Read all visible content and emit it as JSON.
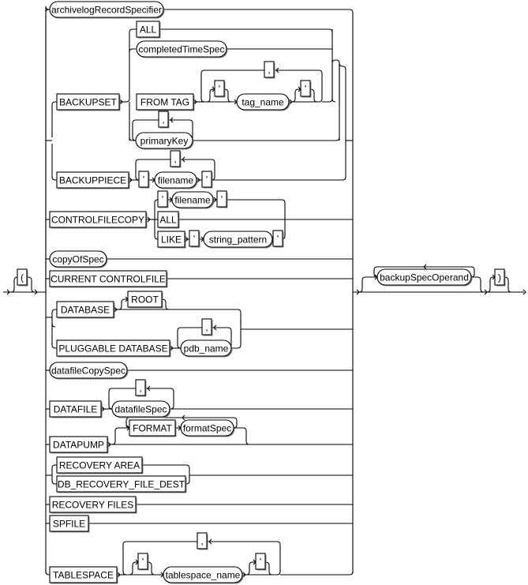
{
  "diagram": {
    "type": "railroad-syntax-diagram",
    "open_paren": "(",
    "close_paren": ")",
    "main_options": [
      {
        "id": "archivelogRecordSpecifier",
        "label": "archivelogRecordSpecifier",
        "kind": "nonterminal"
      },
      {
        "id": "backupset",
        "label": "BACKUPSET",
        "kind": "keyword",
        "sub_options": [
          {
            "label": "ALL",
            "kind": "keyword"
          },
          {
            "label": "completedTimeSpec",
            "kind": "nonterminal"
          },
          {
            "label": "FROM TAG",
            "kind": "keyword",
            "then": [
              {
                "label": "'",
                "kind": "keyword",
                "optional": true
              },
              {
                "label": "tag_name",
                "kind": "nonterminal"
              },
              {
                "label": "'",
                "kind": "keyword",
                "optional": true
              }
            ],
            "repeat_separator": ","
          },
          {
            "label": "primaryKey",
            "kind": "nonterminal",
            "repeat_separator": ","
          }
        ]
      },
      {
        "id": "backuppiece",
        "label": "BACKUPPIECE",
        "kind": "keyword",
        "then": [
          {
            "label": "'",
            "kind": "keyword"
          },
          {
            "label": "filename",
            "kind": "nonterminal"
          },
          {
            "label": "'",
            "kind": "keyword"
          }
        ],
        "repeat_separator": ","
      },
      {
        "id": "controlfilecopy",
        "label": "CONTROLFILECOPY",
        "kind": "keyword",
        "sub_options": [
          {
            "sequence": [
              {
                "label": "'",
                "kind": "keyword"
              },
              {
                "label": "filename",
                "kind": "nonterminal"
              },
              {
                "label": "'",
                "kind": "keyword"
              }
            ]
          },
          {
            "label": "ALL",
            "kind": "keyword"
          },
          {
            "sequence": [
              {
                "label": "LIKE",
                "kind": "keyword"
              },
              {
                "label": "'",
                "kind": "keyword"
              },
              {
                "label": "string_pattern",
                "kind": "nonterminal"
              },
              {
                "label": "'",
                "kind": "keyword"
              }
            ]
          }
        ]
      },
      {
        "id": "copyOfSpec",
        "label": "copyOfSpec",
        "kind": "nonterminal"
      },
      {
        "id": "currentcontrolfile",
        "label": "CURRENT CONTROLFILE",
        "kind": "keyword"
      },
      {
        "id": "database",
        "sub_options": [
          {
            "label": "DATABASE",
            "kind": "keyword",
            "then": [
              {
                "label": "ROOT",
                "kind": "keyword",
                "optional": true
              }
            ]
          },
          {
            "label": "PLUGGABLE DATABASE",
            "kind": "keyword",
            "then": [
              {
                "label": "pdb_name",
                "kind": "nonterminal"
              }
            ],
            "repeat_separator": ","
          }
        ]
      },
      {
        "id": "datafileCopySpec",
        "label": "datafileCopySpec",
        "kind": "nonterminal"
      },
      {
        "id": "datafile",
        "label": "DATAFILE",
        "kind": "keyword",
        "then": [
          {
            "label": "datafileSpec",
            "kind": "nonterminal"
          }
        ],
        "repeat_separator": ","
      },
      {
        "id": "datapump",
        "label": "DATAPUMP",
        "kind": "keyword",
        "then": [
          {
            "label": "FORMAT",
            "kind": "keyword"
          },
          {
            "label": "formatSpec",
            "kind": "nonterminal"
          }
        ],
        "optional_repeat": true
      },
      {
        "id": "recoveryarea",
        "sub_options": [
          {
            "label": "RECOVERY AREA",
            "kind": "keyword"
          },
          {
            "label": "DB_RECOVERY_FILE_DEST",
            "kind": "keyword"
          }
        ]
      },
      {
        "id": "recoveryfiles",
        "label": "RECOVERY FILES",
        "kind": "keyword"
      },
      {
        "id": "spfile",
        "label": "SPFILE",
        "kind": "keyword"
      },
      {
        "id": "tablespace",
        "label": "TABLESPACE",
        "kind": "keyword",
        "then": [
          {
            "label": "'",
            "kind": "keyword",
            "optional": true
          },
          {
            "label": "tablespace_name",
            "kind": "nonterminal"
          },
          {
            "label": "'",
            "kind": "keyword",
            "optional": true
          }
        ],
        "repeat_separator": ","
      }
    ],
    "trailing": {
      "label": "backupSpecOperand",
      "kind": "nonterminal",
      "optional_repeat": true
    },
    "labels": {
      "archivelogRecordSpecifier": "archivelogRecordSpecifier",
      "all": "ALL",
      "completedTimeSpec": "completedTimeSpec",
      "backupset": "BACKUPSET",
      "from_tag": "FROM TAG",
      "quote": "'",
      "comma": ",",
      "tag_name": "tag_name",
      "primaryKey": "primaryKey",
      "backuppiece": "BACKUPPIECE",
      "filename": "filename",
      "controlfilecopy": "CONTROLFILECOPY",
      "like": "LIKE",
      "string_pattern": "string_pattern",
      "copyOfSpec": "copyOfSpec",
      "current_controlfile": "CURRENT CONTROLFILE",
      "database": "DATABASE",
      "root": "ROOT",
      "pluggable_database": "PLUGGABLE DATABASE",
      "pdb_name": "pdb_name",
      "datafileCopySpec": "datafileCopySpec",
      "datafile": "DATAFILE",
      "datafileSpec": "datafileSpec",
      "datapump": "DATAPUMP",
      "format": "FORMAT",
      "formatSpec": "formatSpec",
      "recovery_area": "RECOVERY AREA",
      "db_recovery_file_dest": "DB_RECOVERY_FILE_DEST",
      "recovery_files": "RECOVERY FILES",
      "spfile": "SPFILE",
      "tablespace": "TABLESPACE",
      "tablespace_name": "tablespace_name",
      "backupSpecOperand": "backupSpecOperand",
      "open_paren": "(",
      "close_paren": ")"
    }
  }
}
